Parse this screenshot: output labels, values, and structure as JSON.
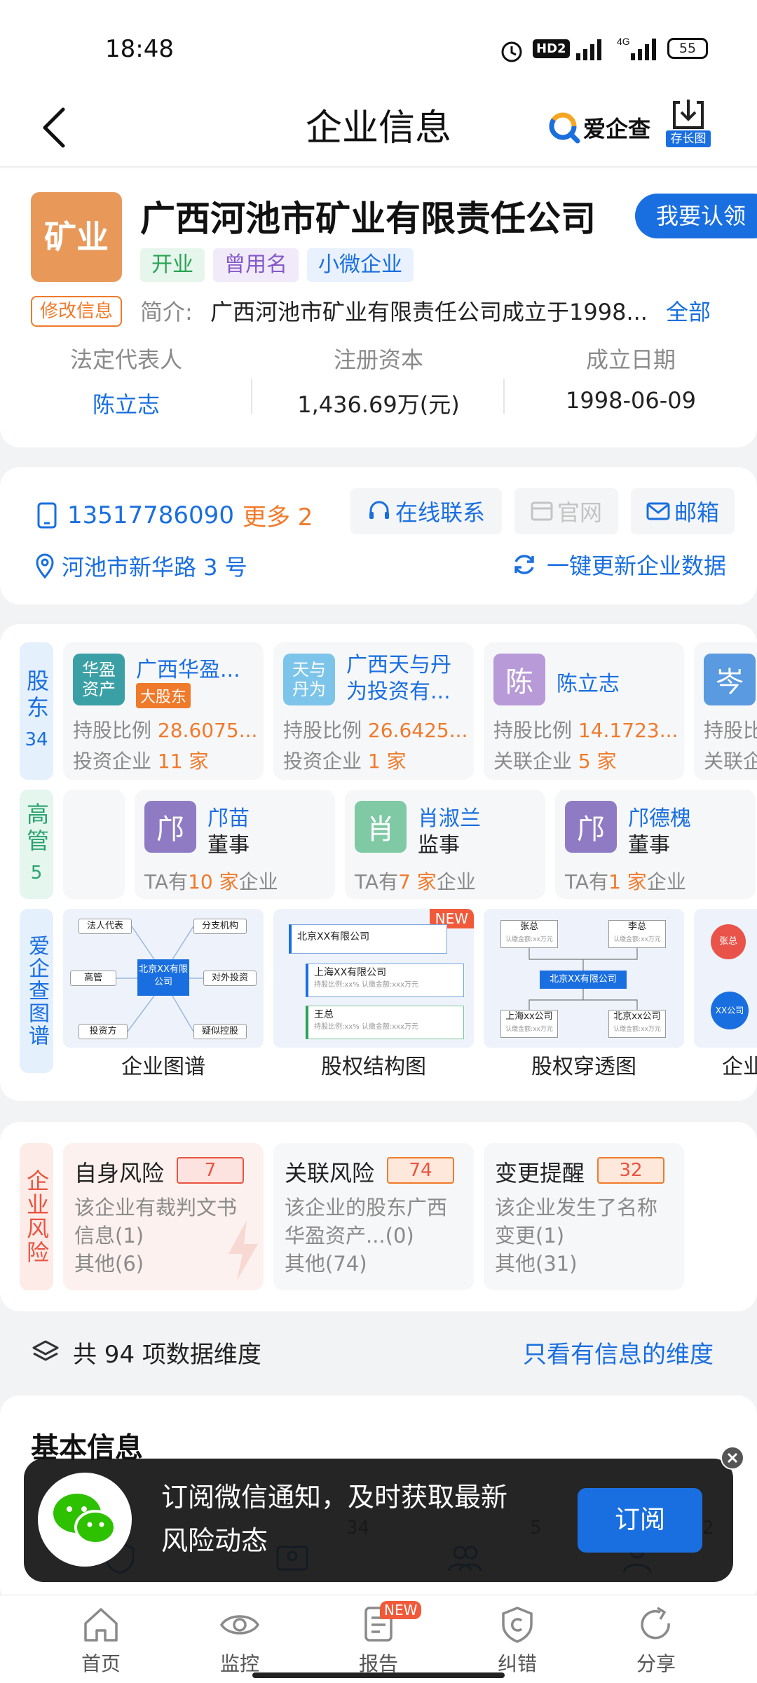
{
  "status_bar": {
    "time": "18:48",
    "hd": "HD2",
    "net": "4G",
    "battery": "55"
  },
  "header": {
    "title": "企业信息",
    "brand": "爱企查",
    "save_long_image": "存长图"
  },
  "company": {
    "logo_text": "矿业",
    "name": "广西河池市矿业有限责任公司",
    "claim_button": "我要认领",
    "tags": [
      "开业",
      "曾用名",
      "小微企业"
    ],
    "edit_info": "修改信息",
    "intro_label": "简介:",
    "intro_text": "广西河池市矿业有限责任公司成立于1998...",
    "intro_all": "全部",
    "stats": [
      {
        "label": "法定代表人",
        "value": "陈立志"
      },
      {
        "label": "注册资本",
        "value": "1,436.69万(元)"
      },
      {
        "label": "成立日期",
        "value": "1998-06-09"
      }
    ]
  },
  "contact": {
    "phone": "13517786090",
    "more": "更多 2",
    "online": "在线联系",
    "website": "官网",
    "email": "邮箱",
    "address": "河池市新华路 3 号",
    "update": "一键更新企业数据"
  },
  "shareholders": {
    "side": "股东",
    "count": "34",
    "items": [
      {
        "avatar": "华盈资产",
        "name": "广西华盈...",
        "badge": "大股东",
        "r1_label": "持股比例",
        "r1_value": "28.6075...",
        "r2_label": "投资企业",
        "r2_value": "11 家"
      },
      {
        "avatar": "天与丹为",
        "name": "广西天与丹为投资有...",
        "badge": "",
        "r1_label": "持股比例",
        "r1_value": "26.6425...",
        "r2_label": "投资企业",
        "r2_value": "1 家"
      },
      {
        "avatar": "陈",
        "name": "陈立志",
        "badge": "",
        "r1_label": "持股比例",
        "r1_value": "14.1723...",
        "r2_label": "关联企业",
        "r2_value": "5 家"
      },
      {
        "avatar": "岑",
        "name": "",
        "badge": "",
        "r1_label": "持股比",
        "r1_value": "",
        "r2_label": "关联企",
        "r2_value": ""
      }
    ]
  },
  "executives": {
    "side": "高管",
    "count": "5",
    "items": [
      {
        "avatar": "邝",
        "name": "邝苗",
        "role": "董事",
        "pre": "TA有",
        "num": "10 家",
        "post": "企业"
      },
      {
        "avatar": "肖",
        "name": "肖淑兰",
        "role": "监事",
        "pre": "TA有",
        "num": "7 家",
        "post": "企业"
      },
      {
        "avatar": "邝",
        "name": "邝德槐",
        "role": "董事",
        "pre": "TA有",
        "num": "1 家",
        "post": "企业"
      }
    ]
  },
  "graphs": {
    "side": "爱企查图谱",
    "items": [
      {
        "label": "企业图谱",
        "center": "北京XX有限公司",
        "nodes": [
          "法人代表",
          "分支机构",
          "高管",
          "对外投资",
          "投资方",
          "疑似控股"
        ]
      },
      {
        "label": "股权结构图",
        "new": "NEW",
        "rows": [
          "北京XX有限公司",
          "上海XX有限公司",
          "王总"
        ],
        "sub": "持股比例:xx%  认缴金额:xxx万元"
      },
      {
        "label": "股权穿透图",
        "top": [
          "张总",
          "李总"
        ],
        "center": "北京XX有限公司",
        "bottom": [
          "上海xx公司",
          "北京xx公司"
        ],
        "sub": "认缴金额:xx万元"
      },
      {
        "label": "企业",
        "nodes": [
          "张总",
          "XX公司"
        ]
      }
    ]
  },
  "risk": {
    "side": "企业风险",
    "items": [
      {
        "title": "自身风险",
        "count": "7",
        "l1": "该企业有裁判文书",
        "l2": "信息(1)",
        "l3": "其他(6)"
      },
      {
        "title": "关联风险",
        "count": "74",
        "l1": "该企业的股东广西",
        "l2": "华盈资产...(0)",
        "l3": "其他(74)"
      },
      {
        "title": "变更提醒",
        "count": "32",
        "l1": "该企业发生了名称",
        "l2": "变更(1)",
        "l3": "其他(31)"
      }
    ]
  },
  "dimensions": {
    "text": "共 94 项数据维度",
    "filter": "只看有信息的维度"
  },
  "basic": {
    "title": "基本信息",
    "counts": [
      "34",
      "5",
      "2"
    ]
  },
  "subscribe": {
    "text": "订阅微信通知，及时获取最新风险动态",
    "line1": "订阅微信通知，及时获取最新",
    "line2": "风险动态",
    "button": "订阅"
  },
  "bottom_nav": [
    {
      "label": "首页",
      "icon": "home-icon"
    },
    {
      "label": "监控",
      "icon": "eye-icon"
    },
    {
      "label": "报告",
      "icon": "report-icon",
      "badge": "NEW"
    },
    {
      "label": "纠错",
      "icon": "correction-icon"
    },
    {
      "label": "分享",
      "icon": "share-icon"
    }
  ],
  "colors": {
    "brand_blue": "#1a6fe0",
    "accent_orange": "#f07a2b",
    "logo_bg": "#e8995a",
    "risk_red": "#e8543f"
  }
}
